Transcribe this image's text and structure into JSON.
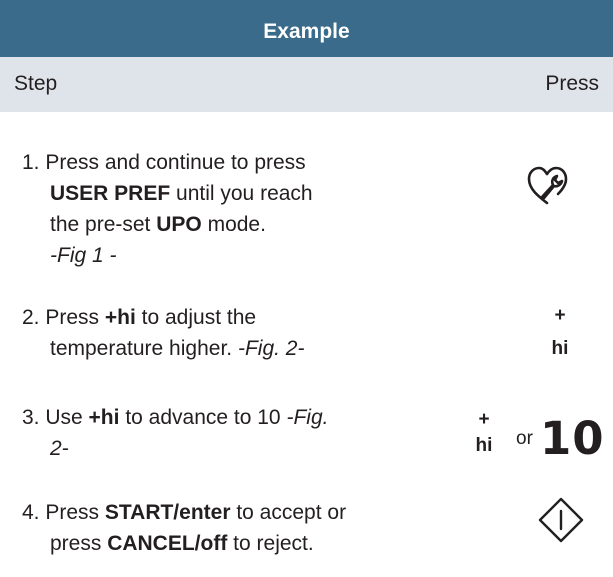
{
  "header": {
    "title": "Example"
  },
  "columns": {
    "step": "Step",
    "press": "Press"
  },
  "steps": [
    {
      "number": "1.",
      "lines": [
        [
          {
            "t": "Press and continue to press",
            "s": "n"
          }
        ],
        [
          {
            "t": "USER PREF",
            "s": "b"
          },
          {
            "t": " until you reach",
            "s": "n"
          }
        ],
        [
          {
            "t": "the pre-set ",
            "s": "n"
          },
          {
            "t": "UPO",
            "s": "b"
          },
          {
            "t": " mode.",
            "s": "n"
          }
        ],
        [
          {
            "t": "-Fig 1 -",
            "s": "i"
          }
        ]
      ],
      "press_icon": "wrench-heart-icon"
    },
    {
      "number": "2.",
      "lines": [
        [
          {
            "t": "Press ",
            "s": "n"
          },
          {
            "t": "+hi",
            "s": "b"
          },
          {
            "t": " to adjust the",
            "s": "n"
          }
        ],
        [
          {
            "t": "temperature higher. ",
            "s": "n"
          },
          {
            "t": "-Fig. 2-",
            "s": "i"
          }
        ]
      ],
      "press_plus": "+",
      "press_hi": "hi"
    },
    {
      "number": "3.",
      "lines": [
        [
          {
            "t": "Use ",
            "s": "n"
          },
          {
            "t": "+hi",
            "s": "b"
          },
          {
            "t": " to advance to 10 ",
            "s": "n"
          },
          {
            "t": "-Fig.",
            "s": "i"
          }
        ],
        [
          {
            "t": "2-",
            "s": "i"
          }
        ]
      ],
      "press_plus": "+",
      "press_hi": "hi",
      "press_or": "or",
      "press_value": "10"
    },
    {
      "number": "4.",
      "lines": [
        [
          {
            "t": "Press ",
            "s": "n"
          },
          {
            "t": "START/enter",
            "s": "b"
          },
          {
            "t": "  to accept or",
            "s": "n"
          }
        ],
        [
          {
            "t": "press ",
            "s": "n"
          },
          {
            "t": "CANCEL/off",
            "s": "b"
          },
          {
            "t": " to reject.",
            "s": "n"
          }
        ]
      ],
      "press_icon": "start-diamond-icon"
    }
  ],
  "colors": {
    "header_bg": "#3a6b8a",
    "subheader_bg": "#dfe4ea",
    "text": "#231f20"
  }
}
